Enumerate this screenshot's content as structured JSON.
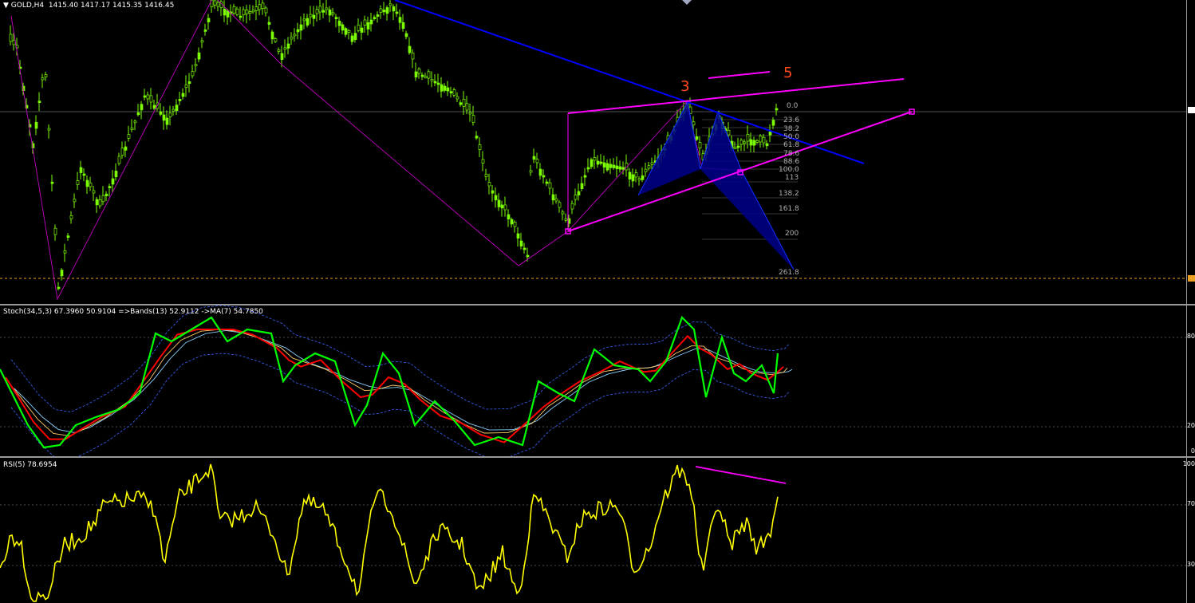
{
  "main": {
    "symbol": "GOLD,H4",
    "ohlc": "1415.40 1417.17 1415.35 1416.45",
    "wave_labels": [
      "3",
      "5"
    ],
    "fib_levels": [
      "0.0",
      "23.6",
      "38.2",
      "50.0",
      "61.8",
      "78.6",
      "88.6",
      "100.0",
      "113",
      "138.2",
      "161.8",
      "200",
      "261.8"
    ],
    "colors": {
      "up_candle": "#7cfc00",
      "trendline": "#0000ff",
      "channel": "#ff00ff",
      "harmonic": "#00008b",
      "wave": "#ff4a1a"
    }
  },
  "stoch": {
    "header": "Stoch(34,5,3) 67.3960 50.9104  =>Bands(13) 52.9112  ->MA(7) 54.7850",
    "levels": [
      "80",
      "20",
      "0"
    ],
    "colors": {
      "main": "#00ff00",
      "signal": "#ff0000",
      "ma": "#ffcc66",
      "bands_mid": "#87cefa",
      "bands": "#3c64ff"
    }
  },
  "rsi": {
    "header": "RSI(5) 78.6954",
    "levels": [
      "100",
      "70",
      "30"
    ],
    "colors": {
      "line": "#ffff00",
      "divergence": "#ff00ff"
    }
  }
}
